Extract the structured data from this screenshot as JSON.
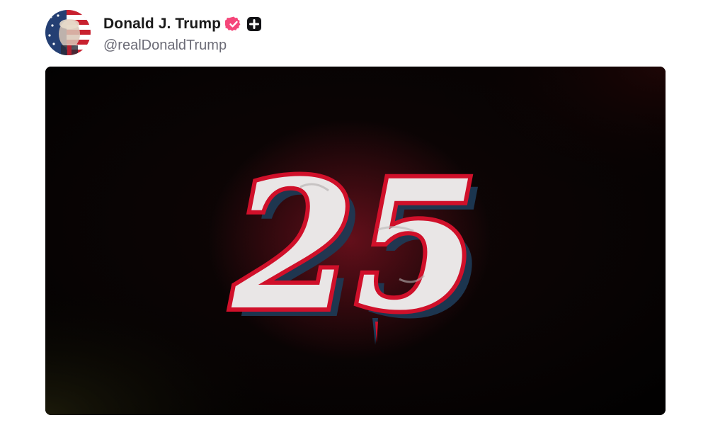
{
  "post": {
    "author": {
      "display_name": "Donald J. Trump",
      "handle": "@realDonaldTrump",
      "avatar_icon": "avatar-flag-portrait",
      "verified_icon": "verified-badge-icon",
      "plus_icon": "plus-badge-icon"
    },
    "media": {
      "overlay_text": "25",
      "type": "video-frame"
    }
  },
  "colors": {
    "verified": "#f5467a",
    "background_media": "#050303",
    "numeral_fill": "#e9e6e6",
    "numeral_outline": "#d0102a",
    "numeral_shadow": "#1d3b57"
  }
}
